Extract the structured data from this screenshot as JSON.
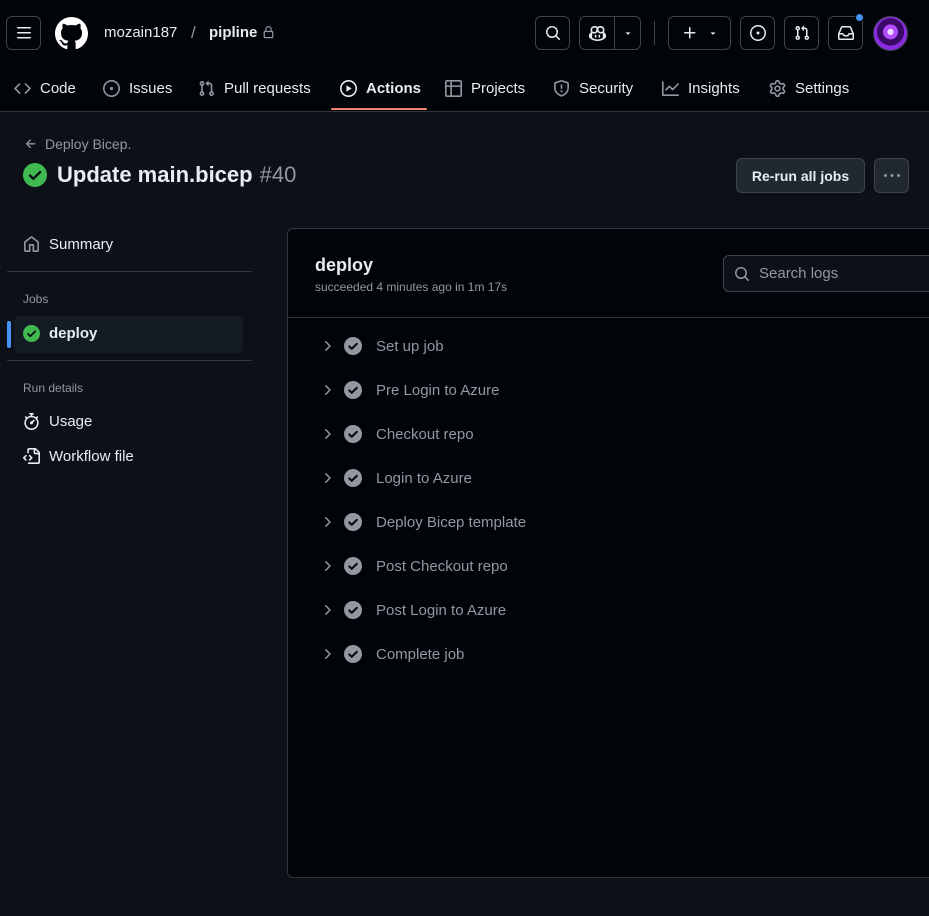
{
  "header": {
    "owner": "mozain187",
    "separator": "/",
    "repo": "pipline"
  },
  "tabs": [
    {
      "label": "Code",
      "icon": "code-icon"
    },
    {
      "label": "Issues",
      "icon": "issue-opened-icon"
    },
    {
      "label": "Pull requests",
      "icon": "git-pull-request-icon"
    },
    {
      "label": "Actions",
      "icon": "play-icon",
      "active": true
    },
    {
      "label": "Projects",
      "icon": "table-icon"
    },
    {
      "label": "Security",
      "icon": "shield-icon"
    },
    {
      "label": "Insights",
      "icon": "graph-icon"
    },
    {
      "label": "Settings",
      "icon": "gear-icon"
    }
  ],
  "run": {
    "back_label": "Deploy Bicep.",
    "title": "Update main.bicep",
    "number": "#40",
    "rerun_label": "Re-run all jobs"
  },
  "sidebar": {
    "summary_label": "Summary",
    "jobs_heading": "Jobs",
    "job_label": "deploy",
    "run_details_heading": "Run details",
    "usage_label": "Usage",
    "workflow_file_label": "Workflow file"
  },
  "job": {
    "name": "deploy",
    "meta": "succeeded 4 minutes ago in 1m 17s",
    "search_placeholder": "Search logs",
    "steps": [
      "Set up job",
      "Pre Login to Azure",
      "Checkout repo",
      "Login to Azure",
      "Deploy Bicep template",
      "Post Checkout repo",
      "Post Login to Azure",
      "Complete job"
    ]
  },
  "colors": {
    "accent_underline": "#f78166",
    "success": "#3fb950",
    "notification_dot": "#4493f8",
    "background": "#0d1117"
  }
}
